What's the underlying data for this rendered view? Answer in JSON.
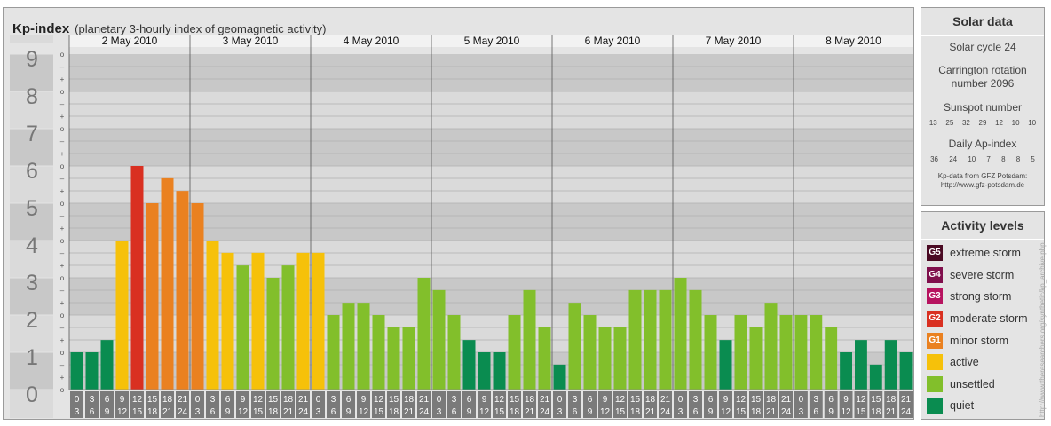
{
  "title": "Kp-index",
  "subtitle": "(planetary 3-hourly index of geomagnetic activity)",
  "chart_data": {
    "type": "bar",
    "ylim": [
      0,
      9
    ],
    "y_ticks": [
      "0",
      "1",
      "2",
      "3",
      "4",
      "5",
      "6",
      "7",
      "8",
      "9"
    ],
    "minor_labels": [
      "o",
      "+",
      "–",
      "o",
      "+",
      "–",
      "o",
      "+",
      "–",
      "o",
      "+",
      "–",
      "o",
      "+",
      "–",
      "o",
      "+",
      "–",
      "o",
      "+",
      "–",
      "o",
      "+",
      "–",
      "o",
      "+",
      "–",
      "o"
    ],
    "days": [
      "2 May 2010",
      "3 May 2010",
      "4 May 2010",
      "5 May 2010",
      "6 May 2010",
      "7 May 2010",
      "8 May 2010"
    ],
    "slot_top": [
      "0",
      "3",
      "6",
      "9",
      "12",
      "15",
      "18",
      "21"
    ],
    "slot_bottom": [
      "3",
      "6",
      "9",
      "12",
      "15",
      "18",
      "21",
      "24"
    ],
    "values": [
      [
        1.0,
        1.0,
        1.33,
        4.0,
        6.0,
        5.0,
        5.67,
        5.33
      ],
      [
        5.0,
        4.0,
        3.67,
        3.33,
        3.67,
        3.0,
        3.33,
        3.67
      ],
      [
        3.67,
        2.0,
        2.33,
        2.33,
        2.0,
        1.67,
        1.67,
        3.0
      ],
      [
        2.67,
        2.0,
        1.33,
        1.0,
        1.0,
        2.0,
        2.67,
        1.67
      ],
      [
        0.67,
        2.33,
        2.0,
        1.67,
        1.67,
        2.67,
        2.67,
        2.67
      ],
      [
        3.0,
        2.67,
        2.0,
        1.33,
        2.0,
        1.67,
        2.33,
        2.0
      ],
      [
        2.0,
        2.0,
        1.67,
        1.0,
        1.33,
        0.67,
        1.33,
        1.0
      ]
    ]
  },
  "solar": {
    "heading": "Solar data",
    "cycle": "Solar cycle 24",
    "carrington": "Carrington rotation number 2096",
    "sunspot_label": "Sunspot number",
    "sunspots": [
      "13",
      "25",
      "32",
      "29",
      "12",
      "10",
      "10"
    ],
    "ap_label": "Daily Ap-index",
    "ap": [
      "36",
      "24",
      "10",
      "7",
      "8",
      "8",
      "5"
    ],
    "source_line1": "Kp-data from GFZ Potsdam:",
    "source_line2": "http://www.gfz-potsdam.de"
  },
  "levels": {
    "heading": "Activity levels",
    "items": [
      {
        "code": "G5",
        "label": "extreme storm",
        "color": "#4a0a23"
      },
      {
        "code": "G4",
        "label": "severe storm",
        "color": "#800f4c"
      },
      {
        "code": "G3",
        "label": "strong storm",
        "color": "#b7135f"
      },
      {
        "code": "G2",
        "label": "moderate storm",
        "color": "#d93021"
      },
      {
        "code": "G1",
        "label": "minor storm",
        "color": "#ea8120"
      },
      {
        "code": "",
        "label": "active",
        "color": "#f6c10a"
      },
      {
        "code": "",
        "label": "unsettled",
        "color": "#82bf2b"
      },
      {
        "code": "",
        "label": "quiet",
        "color": "#0a8c50"
      }
    ]
  },
  "watermark": "http://www.theresearchers.org/synthetic/kp_archive.php"
}
